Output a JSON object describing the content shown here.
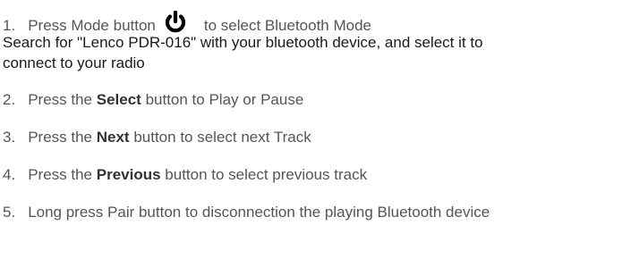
{
  "step1": {
    "number": "1.",
    "before_icon": "Press Mode button",
    "icon": "power-icon",
    "after_icon": "to select Bluetooth Mode",
    "detail_line1": "Search for \"Lenco PDR-016\" with your bluetooth device, and select it to",
    "detail_line2": "connect to your radio"
  },
  "step2": {
    "number": "2.",
    "prefix": "Press the",
    "bold": "Select",
    "suffix": "button to Play or Pause"
  },
  "step3": {
    "number": "3.",
    "prefix": "Press the",
    "bold": "Next",
    "suffix": "button to select next Track"
  },
  "step4": {
    "number": "4.",
    "prefix": "Press the",
    "bold": "Previous",
    "suffix": "button to select previous track"
  },
  "step5": {
    "number": "5.",
    "text": "Long press Pair button to disconnection the playing Bluetooth device"
  }
}
